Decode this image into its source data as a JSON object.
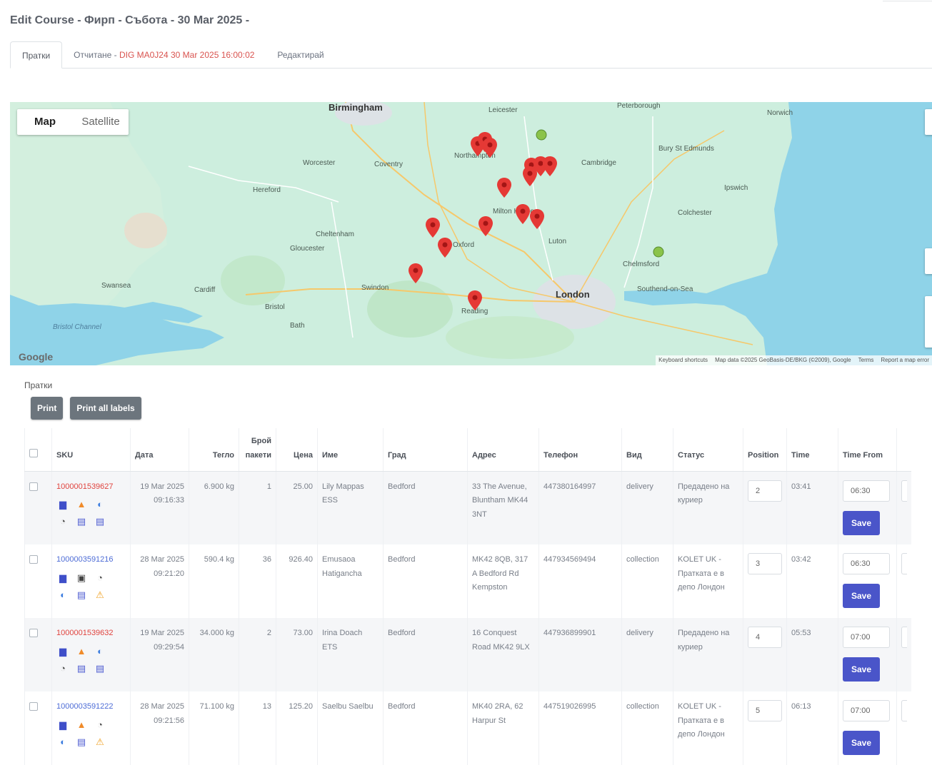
{
  "page": {
    "title": "Edit Course - Фирп - Събота - 30 Mar 2025 -"
  },
  "tabs": [
    {
      "label": "Пратки",
      "active": true
    },
    {
      "label_prefix": "Отчитане - ",
      "label_highlight": "DIG MA0J24 30 Mar 2025 16:00:02"
    },
    {
      "label": "Редактирай"
    }
  ],
  "map": {
    "type_buttons": [
      "Map",
      "Satellite"
    ],
    "labels": [
      {
        "text": "Birmingham"
      },
      {
        "text": "Leicester"
      },
      {
        "text": "Northampton"
      },
      {
        "text": "Cambridge"
      },
      {
        "text": "Ipswich"
      },
      {
        "text": "Colchester"
      },
      {
        "text": "Oxford"
      },
      {
        "text": "Cheltenham"
      },
      {
        "text": "Gloucester"
      },
      {
        "text": "Swindon"
      },
      {
        "text": "Reading"
      },
      {
        "text": "London"
      },
      {
        "text": "Southend-on-Sea"
      },
      {
        "text": "Cardiff"
      },
      {
        "text": "Bristol"
      },
      {
        "text": "Bath"
      },
      {
        "text": "Milton Keynes"
      },
      {
        "text": "Luton"
      },
      {
        "text": "Chelmsford"
      },
      {
        "text": "Swansea"
      },
      {
        "text": "Bury St Edmunds"
      },
      {
        "text": "Hereford"
      },
      {
        "text": "Worcester"
      },
      {
        "text": "Coventry"
      },
      {
        "text": "Peterborough"
      },
      {
        "text": "Norwich"
      }
    ],
    "sea_label": "Bristol Channel",
    "google": "Google",
    "attribution": [
      "Keyboard shortcuts",
      "Map data ©2025 GeoBasis-DE/BKG (©2009), Google",
      "Terms",
      "Report a map error"
    ]
  },
  "section": {
    "label": "Пратки",
    "print_label": "Print",
    "print_all_label": "Print all labels"
  },
  "table": {
    "headers": [
      "SKU",
      "Дата",
      "Тегло",
      "Брой пакети",
      "Цена",
      "Име",
      "Град",
      "Адрес",
      "Телефон",
      "Вид",
      "Статус",
      "Position",
      "Time",
      "Time From"
    ],
    "save_label": "Save",
    "rows": [
      {
        "sku": "1000001539627",
        "sku_color": "red",
        "date": "19 Mar 2025 09:16:33",
        "weight": "6.900 kg",
        "packages": "1",
        "price": "25.00",
        "name": "Lily Mappas ESS",
        "city": "Bedford",
        "address": "33 The Avenue, Bluntham MK44 3NT",
        "phone": "447380164997",
        "type": "delivery",
        "status": "Предадено на куриер",
        "position": "2",
        "time": "03:41",
        "time_from": "06:30",
        "icons": [
          "bus",
          "fire",
          "globe",
          "clock",
          "cal",
          "cal"
        ]
      },
      {
        "sku": "1000003591216",
        "sku_color": "blue",
        "date": "28 Mar 2025 09:21:20",
        "weight": "590.4 kg",
        "packages": "36",
        "price": "926.40",
        "name": "Emusaoa Hatigancha",
        "city": "Bedford",
        "address": "MK42 8QB, 317 A Bedford Rd Kempston",
        "phone": "447934569494",
        "type": "collection",
        "status": "KOLET UK - Пратката е в депо Лондон",
        "position": "3",
        "time": "03:42",
        "time_from": "06:30",
        "icons": [
          "bus",
          "print",
          "clock",
          "globe",
          "cal",
          "warn"
        ]
      },
      {
        "sku": "1000001539632",
        "sku_color": "red",
        "date": "19 Mar 2025 09:29:54",
        "weight": "34.000 kg",
        "packages": "2",
        "price": "73.00",
        "name": "Irina Doach ETS",
        "city": "Bedford",
        "address": "16 Conquest Road MK42 9LX",
        "phone": "447936899901",
        "type": "delivery",
        "status": "Предадено на куриер",
        "position": "4",
        "time": "05:53",
        "time_from": "07:00",
        "icons": [
          "bus",
          "fire",
          "globe",
          "clock",
          "cal",
          "cal"
        ]
      },
      {
        "sku": "1000003591222",
        "sku_color": "blue",
        "date": "28 Mar 2025 09:21:56",
        "weight": "71.100 kg",
        "packages": "13",
        "price": "125.20",
        "name": "Saelbu Saelbu",
        "city": "Bedford",
        "address": "MK40 2RA, 62 Harpur St",
        "phone": "447519026995",
        "type": "collection",
        "status": "KOLET UK - Пратката е в депо Лондон",
        "position": "5",
        "time": "06:13",
        "time_from": "07:00",
        "icons": [
          "bus",
          "fire",
          "clock",
          "globe",
          "cal",
          "warn"
        ]
      }
    ]
  },
  "colors": {
    "accent": "#4a55c9",
    "sku_red": "#e0433e",
    "sku_blue": "#4d6cd6",
    "pin": "#e53935",
    "sea": "#8fd3e8",
    "land": "#cdeede"
  }
}
